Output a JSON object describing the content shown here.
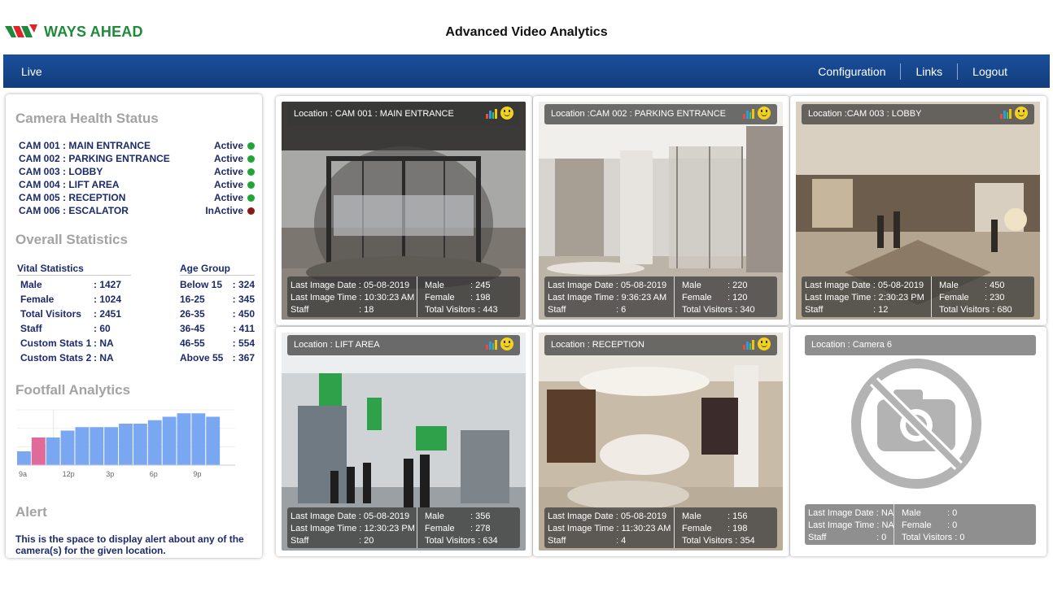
{
  "header": {
    "brand": "WAYS AHEAD",
    "title": "Advanced Video Analytics"
  },
  "nav": {
    "live": "Live",
    "configuration": "Configuration",
    "links": "Links",
    "logout": "Logout"
  },
  "sidebar": {
    "health_title": "Camera Health Status",
    "cameras": [
      {
        "name": "CAM 001 : MAIN ENTRANCE",
        "status": "Active",
        "color": "#1fa43a"
      },
      {
        "name": "CAM 002 : PARKING ENTRANCE",
        "status": "Active",
        "color": "#1fa43a"
      },
      {
        "name": "CAM 003 : LOBBY",
        "status": "Active",
        "color": "#1fa43a"
      },
      {
        "name": "CAM 004 : LIFT AREA",
        "status": "Active",
        "color": "#1fa43a"
      },
      {
        "name": "CAM 005 : RECEPTION",
        "status": "Active",
        "color": "#1fa43a"
      },
      {
        "name": "CAM 006 : ESCALATOR",
        "status": "InActive",
        "color": "#8b1919"
      }
    ],
    "stats_title": "Overall Statistics",
    "vital_heading": "Vital Statistics",
    "vital": [
      {
        "label": "Male",
        "value": ": 1427"
      },
      {
        "label": "Female",
        "value": ": 1024"
      },
      {
        "label": "Total Visitors",
        "value": ": 2451"
      },
      {
        "label": "Staff",
        "value": ": 60"
      },
      {
        "label": "Custom Stats 1",
        "value": ": NA"
      },
      {
        "label": "Custom Stats 2",
        "value": ": NA"
      }
    ],
    "age_heading": "Age Group",
    "age": [
      {
        "label": "Below 15",
        "value": ": 324"
      },
      {
        "label": "16-25",
        "value": ": 345"
      },
      {
        "label": "26-35",
        "value": ": 450"
      },
      {
        "label": "36-45",
        "value": ": 411"
      },
      {
        "label": "46-55",
        "value": ": 554"
      },
      {
        "label": "Above 55",
        "value": ": 367"
      }
    ],
    "footfall_title": "Footfall Analytics",
    "alert_title": "Alert",
    "alert_text": "This is the space to display alert about any of the camera(s) for the given location."
  },
  "chart_data": {
    "type": "bar",
    "categories": [
      "9a",
      "",
      "",
      "12p",
      "",
      "",
      "3p",
      "",
      "",
      "6p",
      "",
      "",
      "9p",
      "",
      ""
    ],
    "tick_labels": [
      "9a",
      "12p",
      "3p",
      "6p",
      "9p"
    ],
    "values": [
      2,
      3,
      4,
      5,
      5.5,
      5.5,
      5.5,
      6,
      6,
      6.5,
      7,
      7.5,
      7.5,
      7,
      0
    ],
    "highlight": {
      "index": 1,
      "value": 4,
      "color": "#e06b9a"
    },
    "bar_color": "#7aa7f2",
    "ylim": [
      0,
      16
    ],
    "grid": true
  },
  "cameras": [
    {
      "location": "Location : CAM 001 : MAIN ENTRANCE",
      "date": "Last Image Date : 05-08-2019",
      "time": "Last Image Time : 10:30:23 AM",
      "staff_label": "Staff",
      "staff": ": 18",
      "male_label": "Male",
      "male": ": 245",
      "female_label": "Female",
      "female": ": 198",
      "total": "Total Visitors : 443",
      "scene": "entrance"
    },
    {
      "location": "Location :CAM 002 : PARKING ENTRANCE",
      "date": "Last Image Date : 05-08-2019",
      "time": "Last Image Time : 9:36:23 AM",
      "staff_label": "Staff",
      "staff": ": 6",
      "male_label": "Male",
      "male": ": 220",
      "female_label": "Female",
      "female": ": 120",
      "total": "Total Visitors : 340",
      "scene": "parking"
    },
    {
      "location": "Location :CAM 003 : LOBBY",
      "date": "Last Image Date : 05-08-2019",
      "time": "Last Image Time : 2:30:23 PM",
      "staff_label": "Staff",
      "staff": ": 12",
      "male_label": "Male",
      "male": ": 450",
      "female_label": "Female",
      "female": ": 230",
      "total": "Total Visitors : 680",
      "scene": "lobby"
    },
    {
      "location": "Location : LIFT AREA",
      "date": "Last Image Date : 05-08-2019",
      "time": "Last Image Time : 12:30:23 PM",
      "staff_label": "Staff",
      "staff": ": 20",
      "male_label": "Male",
      "male": ": 356",
      "female_label": "Female",
      "female": ": 278",
      "total": "Total Visitors : 634",
      "scene": "lift"
    },
    {
      "location": "Location : RECEPTION",
      "date": "Last Image Date : 05-08-2019",
      "time": "Last Image Time : 11:30:23 AM",
      "staff_label": "Staff",
      "staff": ": 4",
      "male_label": "Male",
      "male": ": 156",
      "female_label": "Female",
      "female": ": 198",
      "total": "Total Visitors : 354",
      "scene": "reception"
    },
    {
      "location": "Location : Camera 6",
      "date": "Last Image Date : NA",
      "time": "Last Image Time : NA",
      "staff_label": "Staff",
      "staff": ": 0",
      "male_label": "Male",
      "male": ": 0",
      "female_label": "Female",
      "female": ": 0",
      "total": "Total Visitors : 0",
      "scene": "none"
    }
  ]
}
